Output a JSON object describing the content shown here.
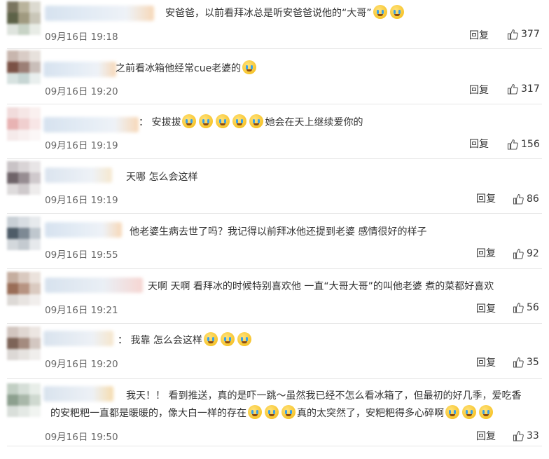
{
  "comments": [
    {
      "text_before": "安爸爸，以前看拜冰总是听安爸爸说他的“大哥”",
      "emojis": 2,
      "text_after": "",
      "time": "09月16日 19:18",
      "reply": "回复",
      "likes": "377"
    },
    {
      "text_before": "之前看冰箱他经常cue老婆的",
      "emojis": 1,
      "text_after": "",
      "time": "09月16日 19:20",
      "reply": "回复",
      "likes": "317"
    },
    {
      "text_before": "：  安拔拔",
      "emojis": 5,
      "text_after": "她会在天上继续爱你的",
      "time": "09月16日 19:19",
      "reply": "回复",
      "likes": "156"
    },
    {
      "text_before": "天哪 怎么会这样",
      "emojis": 0,
      "text_after": "",
      "time": "09月16日 19:19",
      "reply": "回复",
      "likes": "86"
    },
    {
      "text_before": "他老婆生病去世了吗？我记得以前拜冰他还提到老婆 感情很好的样子",
      "emojis": 0,
      "text_after": "",
      "time": "09月16日 19:55",
      "reply": "回复",
      "likes": "92"
    },
    {
      "text_before": "天啊 天啊 看拜冰的时候特别喜欢他 一直“大哥大哥”的叫他老婆 煮的菜都好喜欢",
      "emojis": 0,
      "text_after": "",
      "time": "09月16日 19:21",
      "reply": "回复",
      "likes": "56"
    },
    {
      "text_before": "：  我靠 怎么会这样",
      "emojis": 3,
      "text_after": "",
      "time": "09月16日 19:20",
      "reply": "回复",
      "likes": "35"
    },
    {
      "line1": "我天！！ 看到推送，真的是吓一跳～虽然我已经不怎么看冰箱了，但最初的好几季，爱吃香",
      "line2_before": "的安粑粑一直都是暖暖的，像大白一样的存在",
      "line2_mid": "真的太突然了，安粑粑得多心碎啊",
      "time": "09月16日 19:50",
      "reply": "回复",
      "likes": "33"
    }
  ],
  "icons": {
    "like": "thumbs-up-icon",
    "emoji": "crying-face-emoji"
  },
  "colors": {
    "text": "#333333",
    "time": "#666666",
    "divider": "#e6e6e6"
  }
}
